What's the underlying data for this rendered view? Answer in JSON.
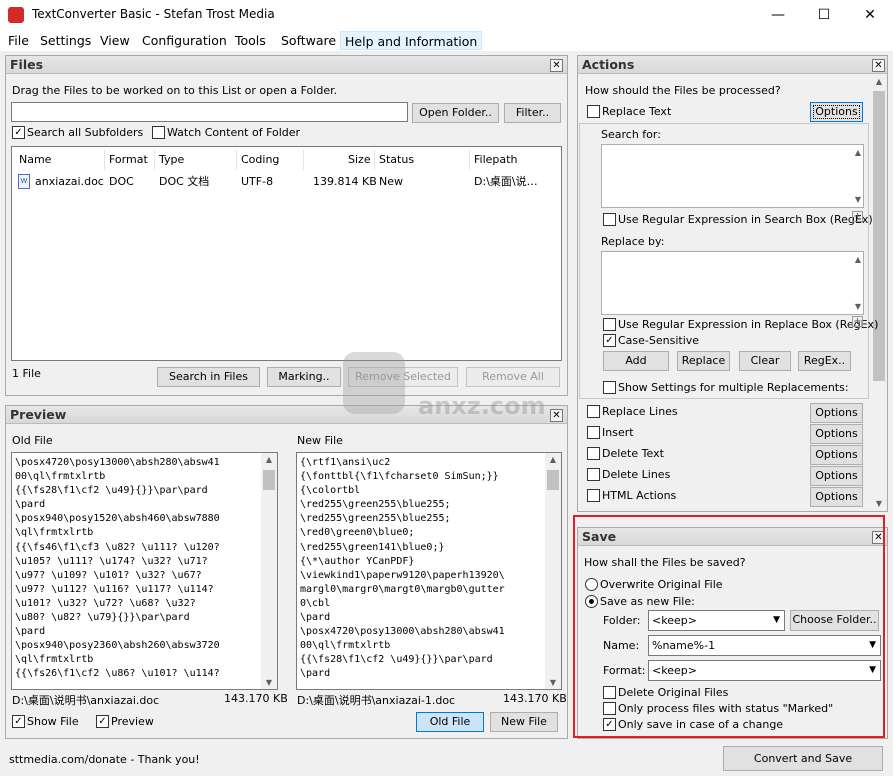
{
  "window": {
    "title": "TextConverter Basic - Stefan Trost Media",
    "minimize": "—",
    "maximize": "☐",
    "close": "✕"
  },
  "menu": [
    "File",
    "Settings",
    "View",
    "Configuration",
    "Tools",
    "Software",
    "Help and Information"
  ],
  "files_panel": {
    "title": "Files",
    "hint": "Drag the Files to be worked on to this List or open a Folder.",
    "path_value": "",
    "open_folder": "Open Folder..",
    "filter": "Filter..",
    "search_subfolders": "Search all Subfolders",
    "search_subfolders_checked": true,
    "watch_content": "Watch Content of Folder",
    "watch_content_checked": false,
    "columns": [
      "Name",
      "Format",
      "Type",
      "Coding",
      "Size",
      "Status",
      "Filepath"
    ],
    "rows": [
      {
        "name": "anxiazai.doc",
        "format": "DOC",
        "type": "DOC 文档",
        "coding": "UTF-8",
        "size": "139.814 KB",
        "status": "New",
        "filepath": "D:\\桌面\\说…"
      }
    ],
    "count": "1 File",
    "search_in_files": "Search in Files",
    "marking": "Marking..",
    "remove_selected": "Remove Selected",
    "remove_all": "Remove All"
  },
  "preview_panel": {
    "title": "Preview",
    "old_label": "Old File",
    "new_label": "New File",
    "old_lines": [
      "\\posx4720\\posy13000\\absh280\\absw41",
      "00\\ql\\frmtxlrtb",
      "{{\\fs28\\f1\\cf2 \\u49}{}}\\par\\pard",
      "\\pard",
      "\\posx940\\posy1520\\absh460\\absw7880",
      "\\ql\\frmtxlrtb",
      "{{\\fs46\\f1\\cf3 \\u82? \\u111? \\u120?",
      "\\u105? \\u111? \\u174? \\u32? \\u71?",
      "\\u97? \\u109? \\u101? \\u32? \\u67?",
      "\\u97? \\u112? \\u116? \\u117? \\u114?",
      "\\u101? \\u32? \\u72? \\u68? \\u32?",
      "\\u80? \\u82? \\u79}{}}\\par\\pard",
      "\\pard",
      "\\posx940\\posy2360\\absh260\\absw3720",
      "\\ql\\frmtxlrtb",
      "{{\\fs26\\f1\\cf2 \\u86? \\u101? \\u114?"
    ],
    "new_lines": [
      "{\\rtf1\\ansi\\uc2",
      "{\\fonttbl{\\f1\\fcharset0 SimSun;}}",
      "{\\colortbl",
      "\\red255\\green255\\blue255;",
      "\\red255\\green255\\blue255;",
      "\\red0\\green0\\blue0;",
      "\\red255\\green141\\blue0;}",
      "{\\*\\author YCanPDF}",
      "\\viewkind1\\paperw9120\\paperh13920\\",
      "margl0\\margr0\\margt0\\margb0\\gutter",
      "0\\cbl",
      "\\pard",
      "\\posx4720\\posy13000\\absh280\\absw41",
      "00\\ql\\frmtxlrtb",
      "{{\\fs28\\f1\\cf2 \\u49}{}}\\par\\pard",
      "\\pard"
    ],
    "old_path": "D:\\桌面\\说明书\\anxiazai.doc",
    "old_size": "143.170 KB",
    "new_path": "D:\\桌面\\说明书\\anxiazai-1.doc",
    "new_size": "143.170 KB",
    "show_file": "Show File",
    "preview": "Preview",
    "old_file_btn": "Old File",
    "new_file_btn": "New File"
  },
  "actions_panel": {
    "title": "Actions",
    "question": "How should the Files be processed?",
    "replace_text": "Replace Text",
    "options": "Options",
    "search_for": "Search for:",
    "regex_search": "Use Regular Expression in Search Box (RegEx)",
    "replace_by": "Replace by:",
    "regex_replace": "Use Regular Expression in Replace Box (RegEx)",
    "case_sensitive": "Case-Sensitive",
    "add": "Add",
    "replace": "Replace",
    "clear": "Clear",
    "regex_btn": "RegEx..",
    "show_settings": "Show Settings for multiple Replacements:",
    "items": [
      "Replace Lines",
      "Insert",
      "Delete Text",
      "Delete Lines",
      "HTML Actions"
    ]
  },
  "save_panel": {
    "title": "Save",
    "question": "How shall the Files be saved?",
    "overwrite": "Overwrite Original File",
    "save_new": "Save as new File:",
    "folder_label": "Folder:",
    "folder_value": "<keep>",
    "choose_folder": "Choose Folder..",
    "name_label": "Name:",
    "name_value": "%name%-1",
    "format_label": "Format:",
    "format_value": "<keep>",
    "delete_original": "Delete Original Files",
    "only_marked": "Only process files with status \"Marked\"",
    "only_change": "Only save in case of a change"
  },
  "footer": {
    "donate": "sttmedia.com/donate - Thank you!",
    "convert": "Convert and Save"
  },
  "watermark": "anxz.com"
}
